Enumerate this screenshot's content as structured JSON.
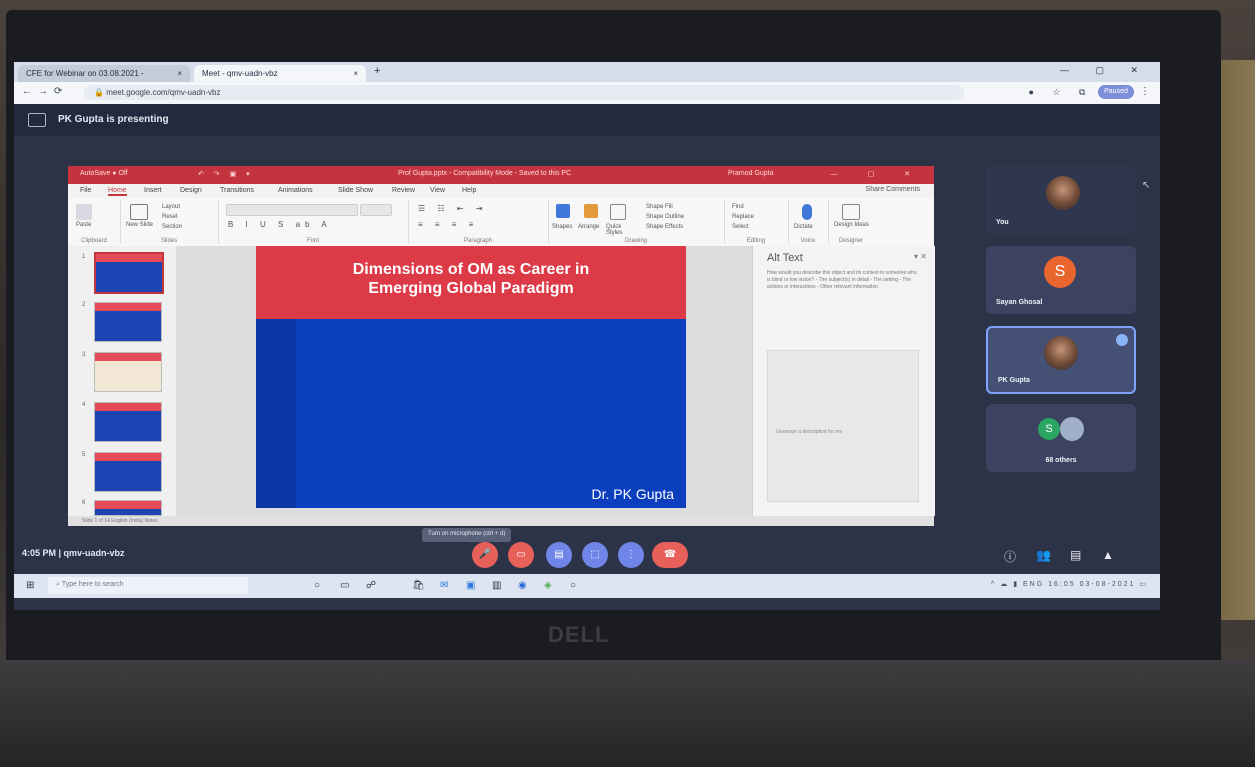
{
  "browser": {
    "tabs": [
      {
        "label": "CFE for Webinar on 03.08.2021 -",
        "active": false
      },
      {
        "label": "Meet - qmv-uadn-vbz",
        "active": true
      }
    ],
    "url": "meet.google.com/qmv-uadn-vbz",
    "profile_label": "Paused"
  },
  "meet": {
    "presenting_banner": "PK Gupta is presenting",
    "time_code": "4:05 PM  |  qmv-uadn-vbz",
    "tooltip": "Turn on microphone (ctrl + d)",
    "tiles": [
      {
        "name": "You"
      },
      {
        "name": "Sayan Ghosal",
        "initial": "S"
      },
      {
        "name": "PK Gupta"
      },
      {
        "name": "68 others",
        "initial": "S"
      }
    ]
  },
  "powerpoint": {
    "title_bar": {
      "autosave": "AutoSave ● Off",
      "document": "Prof Gupta.pptx  -  Compatibility Mode  -  Saved to this PC",
      "user": "Pramod Gupta"
    },
    "ribbon_tabs": [
      "File",
      "Home",
      "Insert",
      "Design",
      "Transitions",
      "Animations",
      "Slide Show",
      "Review",
      "View",
      "Help"
    ],
    "share": "Share  Comments",
    "groups": [
      "Clipboard",
      "Slides",
      "Font",
      "Paragraph",
      "Drawing",
      "Editing",
      "Voice",
      "Designer"
    ],
    "buttons": {
      "paste": "Paste",
      "new_slide": "New Slide",
      "layout": "Layout",
      "reset": "Reset",
      "section": "Section",
      "shapes": "Shapes",
      "arrange": "Arrange",
      "quick_styles": "Quick Styles",
      "shape_fill": "Shape Fill",
      "shape_outline": "Shape Outline",
      "shape_effects": "Shape Effects",
      "find": "Find",
      "replace": "Replace",
      "select": "Select",
      "dictate": "Dictate",
      "design_ideas": "Design Ideas"
    },
    "slide": {
      "title_line1": "Dimensions of OM as Career in",
      "title_line2": "Emerging Global Paradigm",
      "author": "Dr. PK Gupta"
    },
    "thumbnail_numbers": [
      "1",
      "2",
      "3",
      "4",
      "5",
      "6"
    ],
    "alt_text": {
      "title": "Alt Text",
      "description": "How would you describe this object and its context to someone who is blind or low vision? - The subject(s) in detail - The setting - The actions or interactions - Other relevant information",
      "generate": "Generate a description for me"
    },
    "status": "Slide 1 of 14   English (India)   Notes"
  },
  "taskbar": {
    "search_placeholder": "Type here to search",
    "time": "16:05",
    "date": "03-08-2021"
  },
  "laptop_brand": "DELL",
  "colors": {
    "slide_red": "#dd3a48",
    "slide_blue": "#0b3fbd",
    "ppt_red": "#c4343e",
    "meet_end_call": "#e8605a"
  }
}
